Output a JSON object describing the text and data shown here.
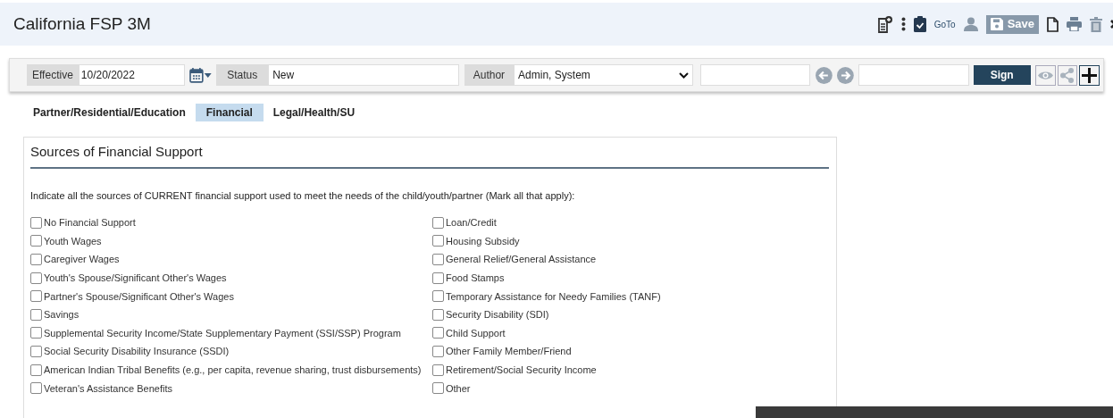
{
  "header": {
    "title": "California FSP 3M",
    "goto": "GoTo",
    "save": "Save"
  },
  "toolbar": {
    "effective_label": "Effective",
    "effective_value": "10/20/2022",
    "status_label": "Status",
    "status_value": "New",
    "author_label": "Author",
    "author_value": "Admin, System",
    "sign": "Sign"
  },
  "tabs": [
    {
      "label": "Partner/Residential/Education",
      "selected": false
    },
    {
      "label": "Financial",
      "selected": true
    },
    {
      "label": "Legal/Health/SU",
      "selected": false
    }
  ],
  "section": {
    "title": "Sources of Financial Support",
    "prompt": "Indicate all the sources of CURRENT financial support used to meet the needs of the child/youth/partner (Mark all that apply):",
    "rows": [
      [
        {
          "label": "No Financial Support",
          "checked": false
        },
        {
          "label": "Loan/Credit",
          "checked": false
        }
      ],
      [
        {
          "label": "Youth Wages",
          "checked": false
        },
        {
          "label": "Housing Subsidy",
          "checked": false
        }
      ],
      [
        {
          "label": "Caregiver Wages",
          "checked": false
        },
        {
          "label": "General Relief/General Assistance",
          "checked": false
        }
      ],
      [
        {
          "label": "Youth's Spouse/Significant Other's Wages",
          "checked": false
        },
        {
          "label": "Food Stamps",
          "checked": false
        }
      ],
      [
        {
          "label": "Partner's Spouse/Significant Other's Wages",
          "checked": false
        },
        {
          "label": "Temporary Assistance for Needy Families (TANF)",
          "checked": false
        }
      ],
      [
        {
          "label": "Savings",
          "checked": false
        },
        {
          "label": "Security Disability (SDI)",
          "checked": false
        }
      ],
      [
        {
          "label": "Supplemental Security Income/State Supplementary Payment (SSI/SSP) Program",
          "checked": false
        },
        {
          "label": "Child Support",
          "checked": false
        }
      ],
      [
        {
          "label": "Social Security Disability Insurance (SSDI)",
          "checked": false
        },
        {
          "label": "Other Family Member/Friend",
          "checked": false
        }
      ],
      [
        {
          "label": "American Indian Tribal Benefits (e.g., per capita, revenue sharing, trust disbursements)",
          "checked": false
        },
        {
          "label": "Retirement/Social Security Income",
          "checked": false
        }
      ],
      [
        {
          "label": "Veteran's Assistance Benefits",
          "checked": false
        },
        {
          "label": "Other",
          "checked": false
        }
      ]
    ]
  }
}
